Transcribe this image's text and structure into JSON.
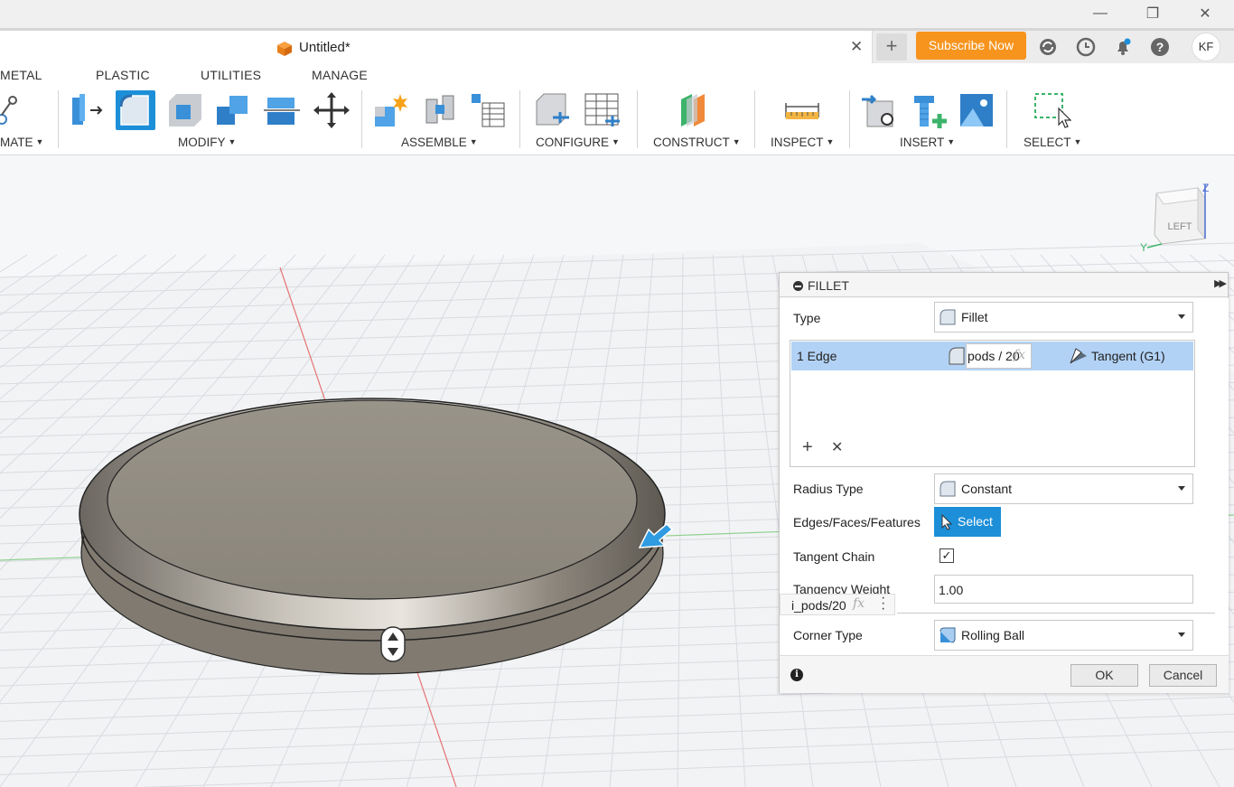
{
  "window": {
    "minimize_glyph": "—",
    "restore_glyph": "❐",
    "close_glyph": "✕"
  },
  "document": {
    "title": "Untitled*",
    "close_glyph": "✕",
    "new_tab_glyph": "+"
  },
  "header": {
    "subscribe_label": "Subscribe Now",
    "avatar_initials": "KF",
    "icons": [
      "sync-icon",
      "history-icon",
      "notifications-icon",
      "help-icon"
    ]
  },
  "toolbar": {
    "tabs": [
      "METAL",
      "PLASTIC",
      "UTILITIES",
      "MANAGE"
    ],
    "groups": [
      {
        "label": "MATE"
      },
      {
        "label": "MODIFY"
      },
      {
        "label": "ASSEMBLE"
      },
      {
        "label": "CONFIGURE"
      },
      {
        "label": "CONSTRUCT"
      },
      {
        "label": "INSPECT"
      },
      {
        "label": "INSERT"
      },
      {
        "label": "SELECT"
      }
    ],
    "caret": "▼"
  },
  "viewcube": {
    "face": "LEFT",
    "axis_z": "Z",
    "axis_y": "Y"
  },
  "fillet_panel": {
    "title": "FILLET",
    "type": {
      "label": "Type",
      "value": "Fillet"
    },
    "edge_row": {
      "edge_label": "1 Edge",
      "expression": "pods / 20",
      "fx": "fx",
      "continuity": "Tangent (G1)"
    },
    "add_glyph": "+",
    "remove_glyph": "✕",
    "radius_type": {
      "label": "Radius Type",
      "value": "Constant"
    },
    "edges_faces": {
      "label": "Edges/Faces/Features",
      "button": "Select"
    },
    "tangent_chain": {
      "label": "Tangent Chain",
      "checked": true,
      "check_glyph": "✓"
    },
    "tangency_weight": {
      "label": "Tangency Weight",
      "value": "1.00"
    },
    "floating_expression": {
      "value": "i_pods/20",
      "fx": "fx"
    },
    "corner_type": {
      "label": "Corner Type",
      "value": "Rolling Ball"
    },
    "info_glyph": "i",
    "ok_label": "OK",
    "cancel_label": "Cancel"
  },
  "colors": {
    "accent": "#1d8fd8",
    "subscribe": "#f7941e",
    "selection_row": "#b2d2f5",
    "model": "#8f897f"
  }
}
